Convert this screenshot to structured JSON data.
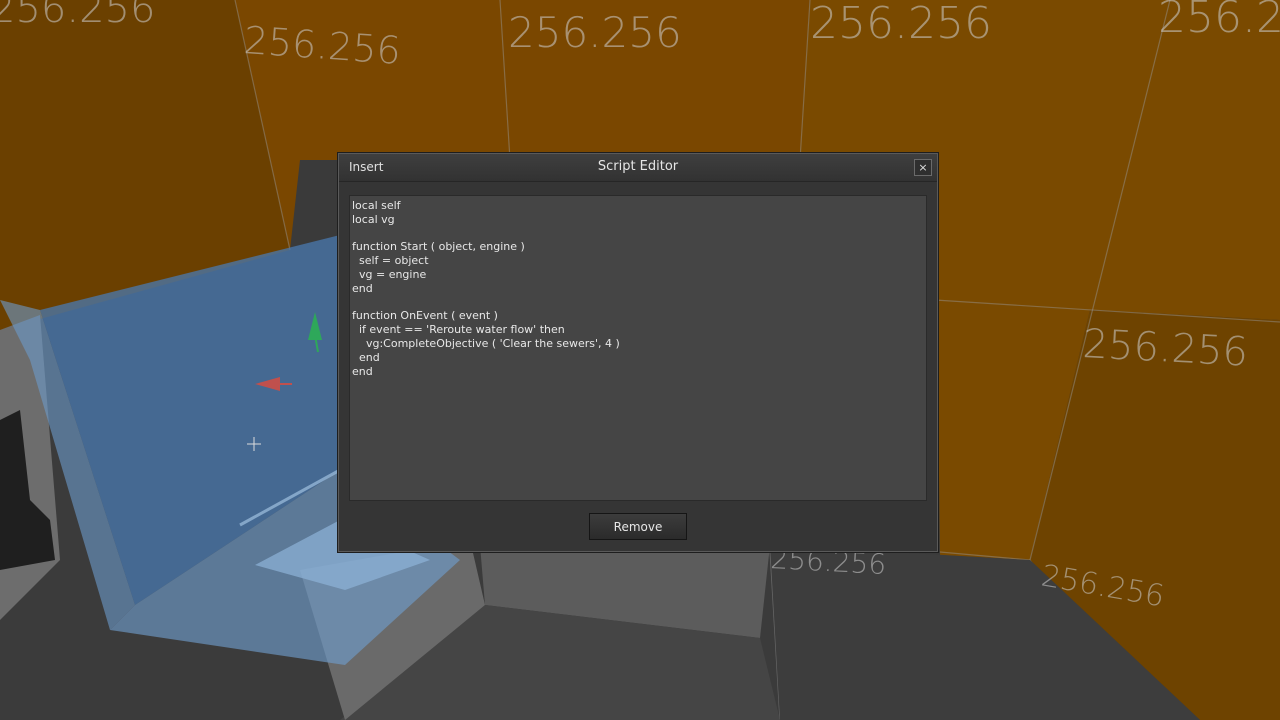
{
  "scene": {
    "grid_label": "256.256",
    "colors": {
      "orange_wall": "#7a4a00",
      "blue_glass": "#4a7fb8",
      "floor": "#3a3a3a"
    },
    "gizmo": {
      "y_axis_color": "#2ea85a",
      "x_axis_color": "#c0504d"
    }
  },
  "dialog": {
    "menu_label": "Insert",
    "title": "Script Editor",
    "close_label": "×",
    "script": "local self\nlocal vg\n\nfunction Start ( object, engine )\n  self = object\n  vg = engine\nend\n\nfunction OnEvent ( event )\n  if event == 'Reroute water flow' then\n    vg:CompleteObjective ( 'Clear the sewers', 4 )\n  end\nend",
    "remove_label": "Remove"
  }
}
